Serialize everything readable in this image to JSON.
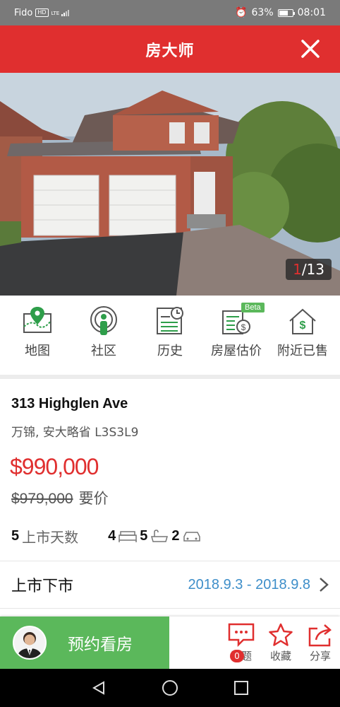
{
  "status_bar": {
    "carrier": "Fido",
    "hd": "HD",
    "net": "LTE",
    "battery": "63%",
    "time": "08:01"
  },
  "header": {
    "title": "房大师"
  },
  "photo": {
    "current": "1",
    "total": "/13"
  },
  "features": [
    {
      "label": "地图",
      "icon": "map-pin-icon"
    },
    {
      "label": "社区",
      "icon": "community-icon"
    },
    {
      "label": "历史",
      "icon": "history-icon"
    },
    {
      "label": "房屋估价",
      "icon": "valuation-icon",
      "badge": "Beta"
    },
    {
      "label": "附近已售",
      "icon": "nearby-sold-icon"
    }
  ],
  "listing": {
    "address": "313 Highglen Ave",
    "locality": "万锦, 安大略省 L3S3L9",
    "price": "$990,000",
    "original_price": "$979,000",
    "original_price_label": "要价",
    "days_on_market": "5",
    "days_label": "上市天数",
    "bedrooms": "4",
    "bathrooms": "5",
    "parking": "2"
  },
  "listing_history": {
    "label": "上市下市",
    "dates": "2018.9.3 - 2018.9.8"
  },
  "bottom_bar": {
    "book_label": "预约看房",
    "topic_label": "话题",
    "topic_count": "0",
    "favorite_label": "收藏",
    "share_label": "分享"
  },
  "colors": {
    "brand_red": "#e02f2f",
    "book_green": "#5bb85b",
    "link_blue": "#3d8ec9",
    "icon_green": "#2e9e4a"
  }
}
